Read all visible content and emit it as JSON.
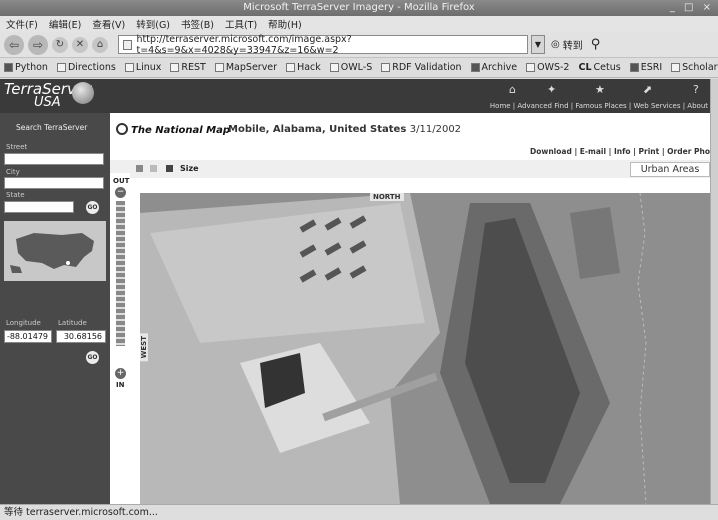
{
  "window": {
    "title": "Microsoft TerraServer Imagery - Mozilla Firefox",
    "controls": "_ □ ×"
  },
  "menu": [
    "文件(F)",
    "编辑(E)",
    "查看(V)",
    "转到(G)",
    "书签(B)",
    "工具(T)",
    "帮助(H)"
  ],
  "nav": {
    "url": "http://terraserver.microsoft.com/image.aspx?t=4&s=9&x=4028&y=33947&z=16&w=2",
    "go_label": "转到"
  },
  "bookmarks": [
    "Python",
    "Directions",
    "Linux",
    "REST",
    "MapServer",
    "Hack",
    "OWL-S",
    "RDF Validation",
    "Archive",
    "OWS-2",
    "Cetus",
    "ESRI",
    "Scholar"
  ],
  "bookmark_cl": "CL",
  "status": "等待 terraserver.microsoft.com...",
  "site": {
    "logo_line1": "TerraServer",
    "logo_line2": "USA",
    "top_links": "Home | Advanced Find | Famous Places | Web Services | About",
    "search_title": "Search TerraServer",
    "labels": {
      "street": "Street",
      "city": "City",
      "state": "State",
      "longitude": "Longitude",
      "latitude": "Latitude"
    },
    "go": "GO",
    "longitude_value": "-88.01479",
    "latitude_value": "30.68156"
  },
  "content": {
    "nm_logo": "The National Map",
    "location": "Mobile, Alabama, United States",
    "date": "3/11/2002",
    "actions": "Download | E-mail | Info | Print | Order Pho",
    "size_label": "Size",
    "theme_tab": "Urban Areas",
    "zoom_out": "OUT",
    "zoom_in": "IN",
    "compass_north": "NORTH",
    "compass_west": "WEST"
  },
  "colors": {
    "sidebar": "#494949",
    "header": "#3a3a3a",
    "water": "#8e8e8e"
  }
}
